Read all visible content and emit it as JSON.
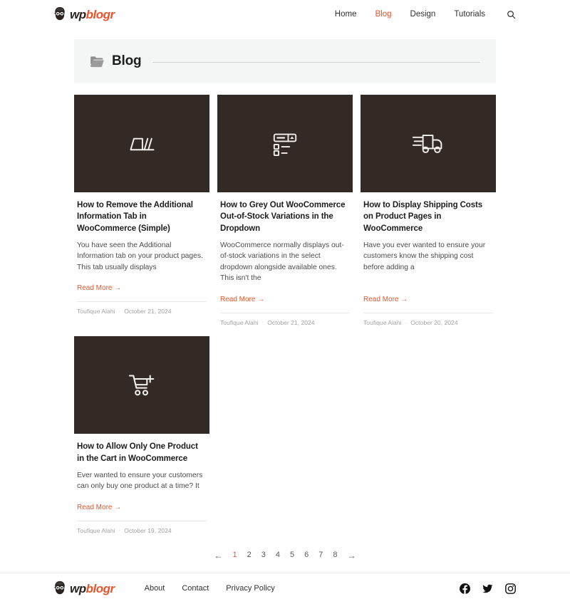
{
  "header": {
    "logo": {
      "icon": "bearded-face-logo-icon",
      "text_primary": "wp",
      "text_accent": "blogr"
    },
    "nav": [
      {
        "label": "Home",
        "active": false
      },
      {
        "label": "Blog",
        "active": true
      },
      {
        "label": "Design",
        "active": false
      },
      {
        "label": "Tutorials",
        "active": false
      }
    ],
    "search_icon": "search-icon"
  },
  "banner": {
    "icon": "folder-icon",
    "title": "Blog"
  },
  "posts": [
    {
      "thumb_icon": "browser-tabs-icon",
      "title": "How to Remove the Additional Information Tab in WooCommerce (Simple)",
      "excerpt": "You have seen the Additional Information tab on your product pages. This tab usually displays",
      "read_more": "Read More →",
      "author": "Toufique Alahi",
      "separator": "·",
      "date": "October 21, 2024"
    },
    {
      "thumb_icon": "dropdown-select-icon",
      "title": "How to Grey Out WooCommerce Out-of-Stock Variations in the Dropdown",
      "excerpt": "WooCommerce normally displays out-of-stock variations in the select dropdown alongside available ones. This isn't the",
      "read_more": "Read More →",
      "author": "Toufique Alahi",
      "separator": "·",
      "date": "October 21, 2024"
    },
    {
      "thumb_icon": "delivery-truck-icon",
      "title": "How to Display Shipping Costs on Product Pages in WooCommerce",
      "excerpt": "Have you ever wanted to ensure your customers know the shipping cost before adding a",
      "read_more": "Read More →",
      "author": "Toufique Alahi",
      "separator": "·",
      "date": "October 20, 2024"
    },
    {
      "thumb_icon": "add-to-cart-icon",
      "title": "How to Allow Only One Product in the Cart in WooCommerce",
      "excerpt": "Ever wanted to ensure your customers can only buy one product at a time? It",
      "read_more": "Read More →",
      "author": "Toufique Alahi",
      "separator": "·",
      "date": "October 19, 2024"
    }
  ],
  "pagination": {
    "prev": "←",
    "next": "→",
    "pages": [
      "1",
      "2",
      "3",
      "4",
      "5",
      "6",
      "7",
      "8"
    ],
    "current": "1"
  },
  "footer": {
    "logo": {
      "icon": "bearded-face-logo-icon",
      "text_primary": "wp",
      "text_accent": "blogr"
    },
    "links": [
      {
        "label": "About"
      },
      {
        "label": "Contact"
      },
      {
        "label": "Privacy Policy"
      }
    ],
    "social": [
      {
        "name": "facebook-icon"
      },
      {
        "name": "twitter-icon"
      },
      {
        "name": "instagram-icon"
      }
    ]
  },
  "colors": {
    "accent": "#e8552b",
    "thumb_bg": "#332925",
    "banner_bg": "#f4f6f6",
    "text_dark": "#1d1d1d",
    "meta_gray": "#a3a3a3"
  }
}
